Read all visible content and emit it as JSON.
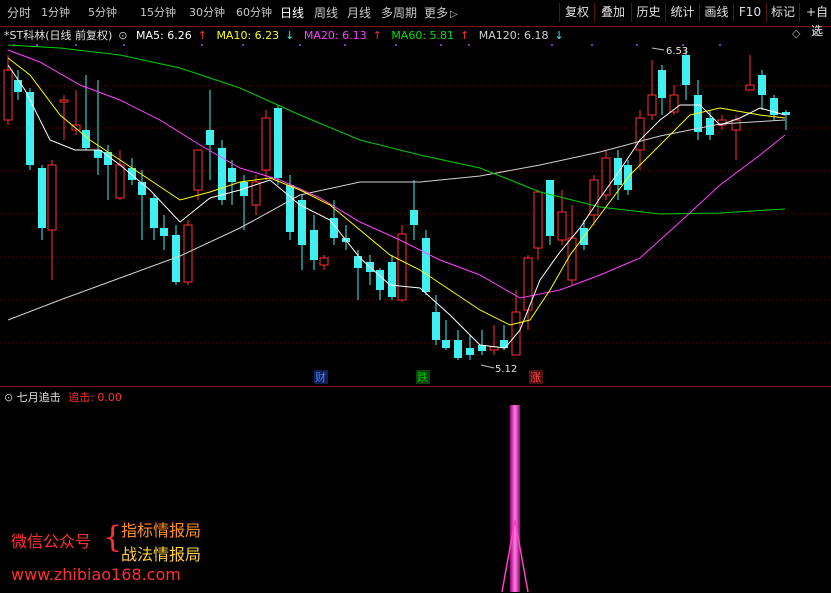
{
  "toolbar": {
    "period_tabs": [
      "分时",
      "1分钟",
      "5分钟",
      "15分钟",
      "30分钟",
      "60分钟",
      "日线",
      "周线",
      "月线",
      "多周期",
      "更多"
    ],
    "active_tab": "日线",
    "right_buttons": [
      "复权",
      "叠加",
      "历史",
      "统计",
      "画线",
      "F10",
      "标记",
      "+自选"
    ]
  },
  "main_chart": {
    "stock_title": "*ST科林(日线 前复权)",
    "ma_legend": [
      {
        "label": "MA5: 6.26",
        "arrow": "↑",
        "color": "#ffffff"
      },
      {
        "label": "MA10: 6.23",
        "arrow": "↓",
        "color": "#ffff00"
      },
      {
        "label": "MA20: 6.13",
        "arrow": "↑",
        "color": "#ff40ff"
      },
      {
        "label": "MA60: 5.81",
        "arrow": "↑",
        "color": "#00e000"
      },
      {
        "label": "MA120: 6.18",
        "arrow": "↓",
        "color": "#d0d0d0"
      }
    ],
    "high_label": "6.53",
    "low_label": "5.12",
    "event_markers": [
      {
        "text": "财",
        "color": "#4080ff"
      },
      {
        "text": "跌",
        "color": "#00c000"
      },
      {
        "text": "涨",
        "color": "#ff4040"
      }
    ]
  },
  "sub_chart": {
    "indicator_name": "七月追击",
    "indicator_value": "追击: 0.00"
  },
  "watermark": {
    "left": "微信公众号",
    "brace": "{",
    "line1": "指标情报局",
    "line2": "战法情报局",
    "url": "www.zhibiao168.com"
  },
  "colors": {
    "up": "#ff3030",
    "down": "#40f0f0",
    "border": "#7a1010",
    "signal": "#ff40c0"
  }
}
